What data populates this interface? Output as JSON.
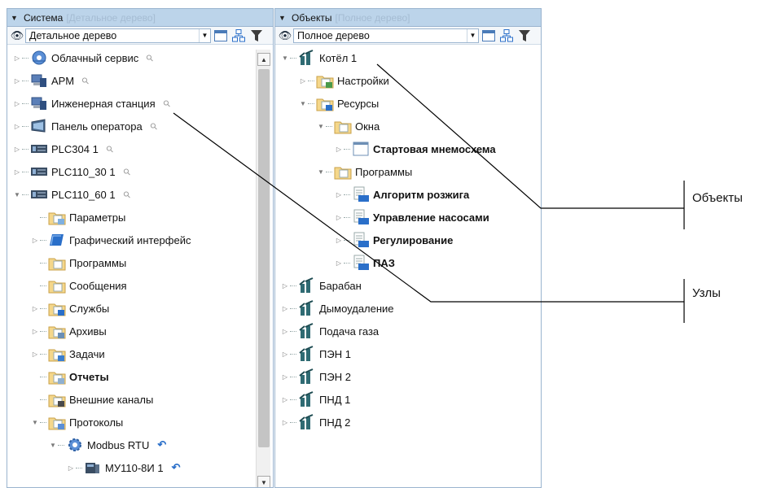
{
  "left_panel": {
    "header_title": "Система",
    "header_subtitle": "[Детальное дерево]",
    "mode_value": "Детальное дерево",
    "items": [
      {
        "label": "Облачный сервис",
        "indent": 0,
        "expander": "collapsed",
        "icon": "cloud-service-icon",
        "pin": true
      },
      {
        "label": "АРМ",
        "indent": 0,
        "expander": "collapsed",
        "icon": "workstation-icon",
        "pin": true
      },
      {
        "label": "Инженерная станция",
        "indent": 0,
        "expander": "collapsed",
        "icon": "workstation-icon",
        "pin": true
      },
      {
        "label": "Панель оператора",
        "indent": 0,
        "expander": "collapsed",
        "icon": "operator-panel-icon",
        "pin": true
      },
      {
        "label": "PLC304 1",
        "indent": 0,
        "expander": "collapsed",
        "icon": "plc-icon",
        "pin": true
      },
      {
        "label": "PLC110_30 1",
        "indent": 0,
        "expander": "collapsed",
        "icon": "plc-icon",
        "pin": true
      },
      {
        "label": "PLC110_60 1",
        "indent": 0,
        "expander": "expanded",
        "icon": "plc-icon",
        "pin": true
      },
      {
        "label": "Параметры",
        "indent": 1,
        "expander": "none",
        "icon": "params-folder-icon"
      },
      {
        "label": "Графический интерфейс",
        "indent": 1,
        "expander": "collapsed",
        "icon": "gui-folder-icon"
      },
      {
        "label": "Программы",
        "indent": 1,
        "expander": "none",
        "icon": "programs-folder-icon"
      },
      {
        "label": "Сообщения",
        "indent": 1,
        "expander": "none",
        "icon": "messages-folder-icon"
      },
      {
        "label": "Службы",
        "indent": 1,
        "expander": "collapsed",
        "icon": "services-folder-icon"
      },
      {
        "label": "Архивы",
        "indent": 1,
        "expander": "collapsed",
        "icon": "archives-folder-icon"
      },
      {
        "label": "Задачи",
        "indent": 1,
        "expander": "collapsed",
        "icon": "tasks-folder-icon"
      },
      {
        "label": "Отчеты",
        "indent": 1,
        "expander": "none",
        "icon": "reports-folder-icon",
        "bold": true
      },
      {
        "label": "Внешние каналы",
        "indent": 1,
        "expander": "none",
        "icon": "channels-folder-icon"
      },
      {
        "label": "Протоколы",
        "indent": 1,
        "expander": "expanded",
        "icon": "protocols-folder-icon"
      },
      {
        "label": "Modbus RTU",
        "indent": 2,
        "expander": "expanded",
        "icon": "modbus-icon",
        "undo": true
      },
      {
        "label": "МУ110-8И 1",
        "indent": 3,
        "expander": "collapsed",
        "icon": "module-icon",
        "undo": true
      }
    ]
  },
  "right_panel": {
    "header_title": "Объекты",
    "header_subtitle": "[Полное дерево]",
    "mode_value": "Полное дерево",
    "items": [
      {
        "label": "Котёл 1",
        "indent": 0,
        "expander": "expanded",
        "icon": "plant-object-icon"
      },
      {
        "label": "Настройки",
        "indent": 1,
        "expander": "collapsed",
        "icon": "settings-folder-icon"
      },
      {
        "label": "Ресурсы",
        "indent": 1,
        "expander": "expanded",
        "icon": "resources-folder-icon"
      },
      {
        "label": "Окна",
        "indent": 2,
        "expander": "expanded",
        "icon": "windows-folder-icon"
      },
      {
        "label": "Стартовая мнемосхема",
        "indent": 3,
        "expander": "collapsed",
        "icon": "screen-icon",
        "bold": true
      },
      {
        "label": "Программы",
        "indent": 2,
        "expander": "expanded",
        "icon": "programs-folder-icon"
      },
      {
        "label": "Алгоритм розжига",
        "indent": 3,
        "expander": "collapsed",
        "icon": "fbd-program-icon",
        "tag": "FBD",
        "bold": true
      },
      {
        "label": "Управление насосами",
        "indent": 3,
        "expander": "collapsed",
        "icon": "fbd-program-icon",
        "tag": "FBD",
        "bold": true
      },
      {
        "label": "Регулирование",
        "indent": 3,
        "expander": "collapsed",
        "icon": "st-program-icon",
        "tag": "ST",
        "bold": true
      },
      {
        "label": "ПАЗ",
        "indent": 3,
        "expander": "collapsed",
        "icon": "st-program-icon",
        "tag": "ST",
        "bold": true
      },
      {
        "label": "Барабан",
        "indent": 0,
        "expander": "collapsed",
        "icon": "plant-object-icon"
      },
      {
        "label": "Дымоудаление",
        "indent": 0,
        "expander": "collapsed",
        "icon": "plant-object-icon"
      },
      {
        "label": "Подача газа",
        "indent": 0,
        "expander": "collapsed",
        "icon": "plant-object-icon"
      },
      {
        "label": "ПЭН 1",
        "indent": 0,
        "expander": "collapsed",
        "icon": "plant-object-icon"
      },
      {
        "label": "ПЭН 2",
        "indent": 0,
        "expander": "collapsed",
        "icon": "plant-object-icon"
      },
      {
        "label": "ПНД 1",
        "indent": 0,
        "expander": "collapsed",
        "icon": "plant-object-icon"
      },
      {
        "label": "ПНД 2",
        "indent": 0,
        "expander": "collapsed",
        "icon": "plant-object-icon"
      }
    ]
  },
  "callouts": {
    "objects": "Объекты",
    "nodes": "Узлы"
  },
  "colors": {
    "header_bg": "#bcd4ea",
    "border": "#9ab4cf",
    "header_subtitle": "#a5bcd3",
    "folder": "#f5d78a",
    "plc": "#3a4d63",
    "object": "#2f6b73"
  }
}
